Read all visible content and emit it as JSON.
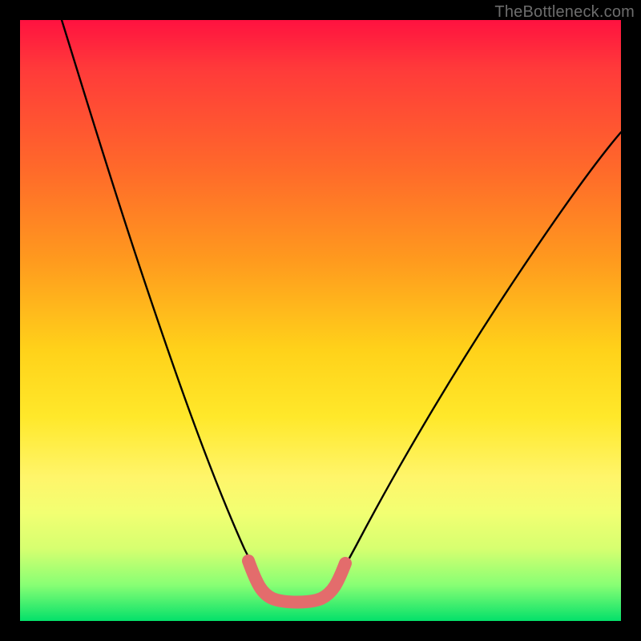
{
  "watermark": "TheBottleneck.com",
  "colors": {
    "page_bg": "#000000",
    "curve_stroke": "#000000",
    "base_stroke": "#e36c6c",
    "gradient_top": "#ff1240",
    "gradient_mid": "#ffe82a",
    "gradient_bottom": "#04e06a"
  },
  "chart_data": {
    "type": "line",
    "title": "",
    "xlabel": "",
    "ylabel": "",
    "xlim": [
      0,
      100
    ],
    "ylim": [
      0,
      100
    ],
    "annotations": [
      "TheBottleneck.com"
    ],
    "description": "V-shaped bottleneck curve on rainbow gradient; left arm descends from top-left, flat minimum with pink highlight near x≈40–50, right arm rises toward top-right. No axis ticks or numeric labels are rendered.",
    "series": [
      {
        "name": "bottleneck-curve",
        "x": [
          7,
          12,
          17,
          22,
          27,
          32,
          37,
          40,
          44,
          50,
          53,
          58,
          63,
          70,
          78,
          86,
          94,
          100
        ],
        "y": [
          100,
          87,
          74,
          61,
          48,
          35,
          22,
          10,
          3,
          3,
          10,
          22,
          34,
          45,
          56,
          66,
          74,
          80
        ]
      }
    ],
    "highlight": {
      "name": "minimum-plateau",
      "x_range": [
        38,
        52
      ],
      "y": 3
    }
  }
}
